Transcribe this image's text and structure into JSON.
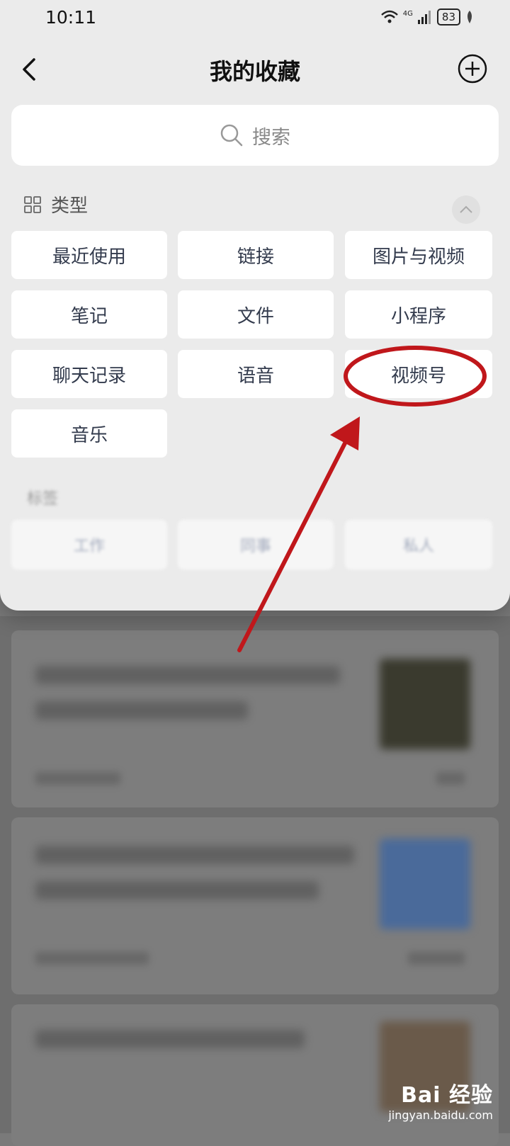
{
  "status_bar": {
    "time": "10:11",
    "network": "4G",
    "battery": "83"
  },
  "header": {
    "title": "我的收藏"
  },
  "search": {
    "placeholder": "搜索"
  },
  "types": {
    "title": "类型",
    "items": [
      "最近使用",
      "链接",
      "图片与视频",
      "笔记",
      "文件",
      "小程序",
      "聊天记录",
      "语音",
      "视频号",
      "音乐"
    ]
  },
  "tags": {
    "title": "标签",
    "items": [
      "工作",
      "同事",
      "私人"
    ]
  },
  "watermark": {
    "logo": "Bai 经验",
    "url": "jingyan.baidu.com"
  },
  "colors": {
    "annotation": "#c0171b",
    "sheet": "#ebebeb",
    "tile": "#ffffff"
  }
}
